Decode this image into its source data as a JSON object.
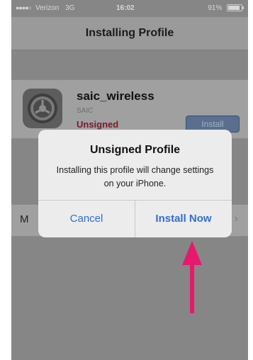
{
  "status_bar": {
    "signal_dots": "●●●●○",
    "carrier": "Verizon",
    "network": "3G",
    "time": "16:02",
    "battery": "91%",
    "battery_level": 0.91
  },
  "nav": {
    "title": "Installing Profile"
  },
  "profile": {
    "name": "saic_wireless",
    "organization": "SAIC",
    "status": "Unsigned",
    "install_label": "Install",
    "icon": "settings-gear-icon"
  },
  "more_row": {
    "label": "M",
    "chevron": "›"
  },
  "alert": {
    "title": "Unsigned Profile",
    "message": "Installing this profile will change settings on your iPhone.",
    "cancel_label": "Cancel",
    "confirm_label": "Install Now"
  },
  "annotation": {
    "icon": "up-arrow-icon",
    "color": "#e8186c"
  },
  "colors": {
    "alert_button": "#2f6fd3",
    "unsigned": "#7a1a2b",
    "dim_background": "#868686"
  }
}
